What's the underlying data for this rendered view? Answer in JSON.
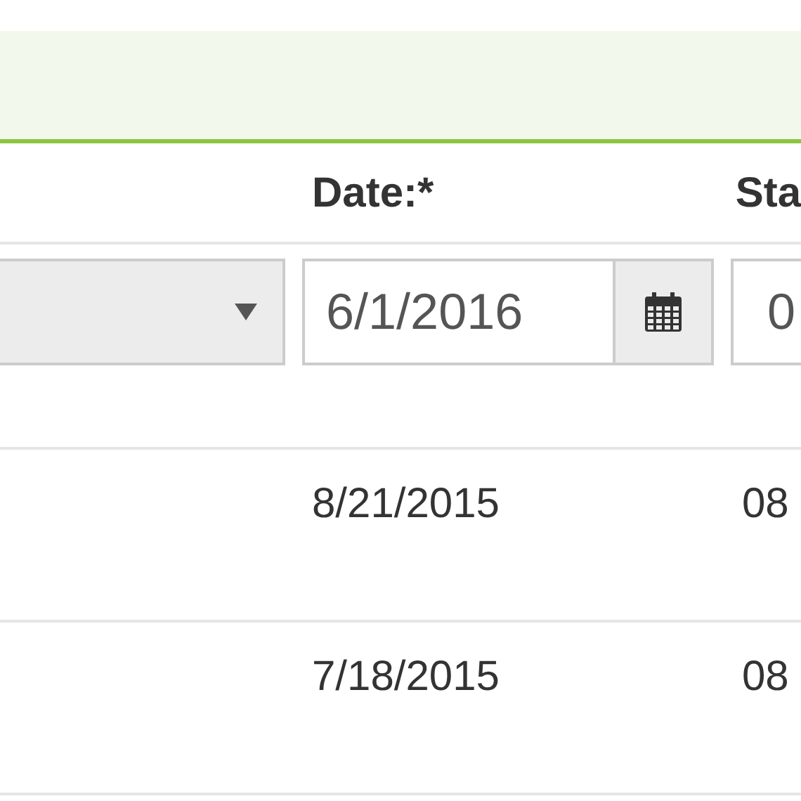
{
  "header": {
    "date": "Date:*",
    "column_3": "Sta"
  },
  "filters": [
    {
      "kind": "select"
    },
    {
      "kind": "date",
      "value": "6/1/2016"
    },
    {
      "kind": "text",
      "value": "0"
    }
  ],
  "rows": [
    {
      "date": "8/21/2015",
      "column_3": "08"
    },
    {
      "date": "7/18/2015",
      "column_3": "08"
    }
  ]
}
